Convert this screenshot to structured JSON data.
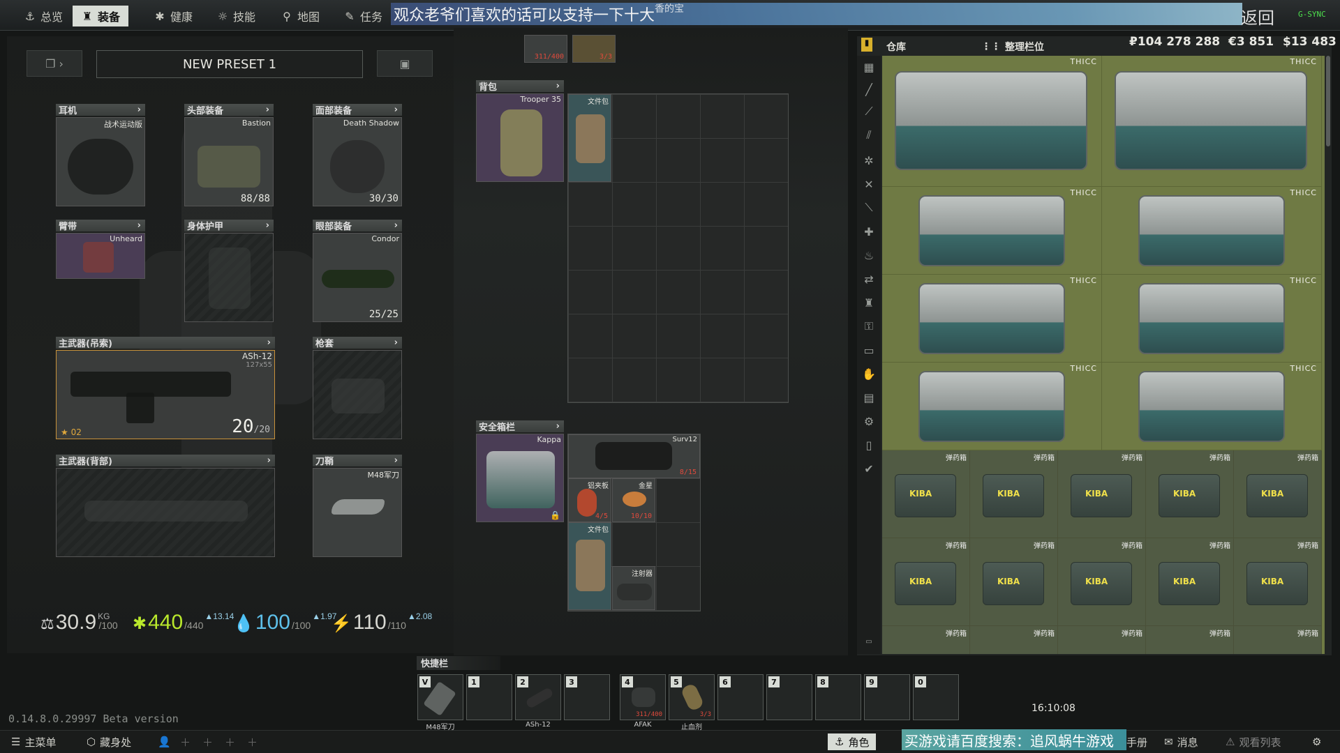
{
  "tabs": [
    {
      "label": "总览",
      "icon": "anchor-icon"
    },
    {
      "label": "装备",
      "icon": "character-icon"
    },
    {
      "label": "健康",
      "icon": "health-icon"
    },
    {
      "label": "技能",
      "icon": "skills-icon"
    },
    {
      "label": "地图",
      "icon": "map-pin-icon"
    },
    {
      "label": "任务",
      "icon": "tasks-icon"
    }
  ],
  "overlay_top": "观众老爷们喜欢的话可以支持一下十大",
  "overlay_top_tail": "香的宝",
  "back_label": "返回",
  "gsync": "G-SYNC",
  "preset": {
    "name": "NEW PRESET 1"
  },
  "slots": {
    "earpiece": {
      "header": "耳机",
      "item": "战术运动版"
    },
    "headwear": {
      "header": "头部装备",
      "item": "Bastion",
      "durability": "88/88"
    },
    "facecover": {
      "header": "面部装备",
      "item": "Death Shadow",
      "durability": "30/30"
    },
    "armband": {
      "header": "臂带",
      "item": "Unheard"
    },
    "armor": {
      "header": "身体护甲"
    },
    "eyewear": {
      "header": "眼部装备",
      "item": "Condor",
      "durability": "25/25"
    },
    "primary": {
      "header": "主武器(吊索)",
      "item": "ASh-12",
      "caliber": "127x55",
      "ammo": "20",
      "ammo_max": "/20",
      "level": "02"
    },
    "holster": {
      "header": "枪套"
    },
    "primary_back": {
      "header": "主武器(背部)"
    },
    "scabbard": {
      "header": "刀鞘",
      "item": "M48军刀"
    }
  },
  "stats": {
    "weight": {
      "value": "30.9",
      "unit": "KG",
      "max": "/100"
    },
    "energy": {
      "value": "440",
      "max": "/440",
      "delta": "▲13.14"
    },
    "hydration": {
      "value": "100",
      "max": "/100",
      "delta": "▲1.97"
    },
    "stamina": {
      "value": "110",
      "max": "/110",
      "delta": "▲2.08"
    }
  },
  "version": "0.14.8.0.29997 Beta version",
  "top_items": {
    "a": "311/400",
    "b": "3/3"
  },
  "backpack": {
    "header": "背包",
    "item": "Trooper 35",
    "doc_case": "文件包"
  },
  "secure": {
    "header": "安全箱栏",
    "item": "Kappa",
    "surv12": "Surv12",
    "surv12_count": "8/15",
    "aluminum": "铝夹板",
    "aluminum_count": "4/5",
    "golden_star": "金星",
    "golden_star_count": "10/10",
    "doc_case": "文件包",
    "injector": "注射器"
  },
  "stash": {
    "tab_label": "仓库",
    "sort_label": "整理栏位",
    "money": {
      "rub": "₽104 278 288",
      "eur": "€3 851",
      "usd": "$13 483"
    },
    "case_label": "THICC",
    "ammo_label": "弹药箱",
    "ammo_brand": "KIBA"
  },
  "quickbar": {
    "label": "快捷栏",
    "slots": [
      {
        "key": "V",
        "name": "M48军刀"
      },
      {
        "key": "1",
        "name": ""
      },
      {
        "key": "2",
        "name": "ASh-12"
      },
      {
        "key": "3",
        "name": ""
      },
      {
        "key": "4",
        "name": "AFAK",
        "count": "311/400"
      },
      {
        "key": "5",
        "name": "止血剂",
        "count": "3/3"
      },
      {
        "key": "6",
        "name": ""
      },
      {
        "key": "7",
        "name": ""
      },
      {
        "key": "8",
        "name": ""
      },
      {
        "key": "9",
        "name": ""
      },
      {
        "key": "0",
        "name": ""
      }
    ]
  },
  "clock": "16:10:08",
  "bottom": {
    "main_menu": "主菜单",
    "hideout": "藏身处",
    "character": "角色",
    "handbook_tail": "手册",
    "messages": "消息",
    "watchlist": "观看列表"
  },
  "overlay_bottom": "买游戏请百度搜索：追风蜗牛游戏",
  "colors": {
    "stash_bg": "#6f7a44",
    "accent_active_tab": "#d8dcd6",
    "red_count": "#e04a3c",
    "overlay_blue": "#4c76a0"
  }
}
